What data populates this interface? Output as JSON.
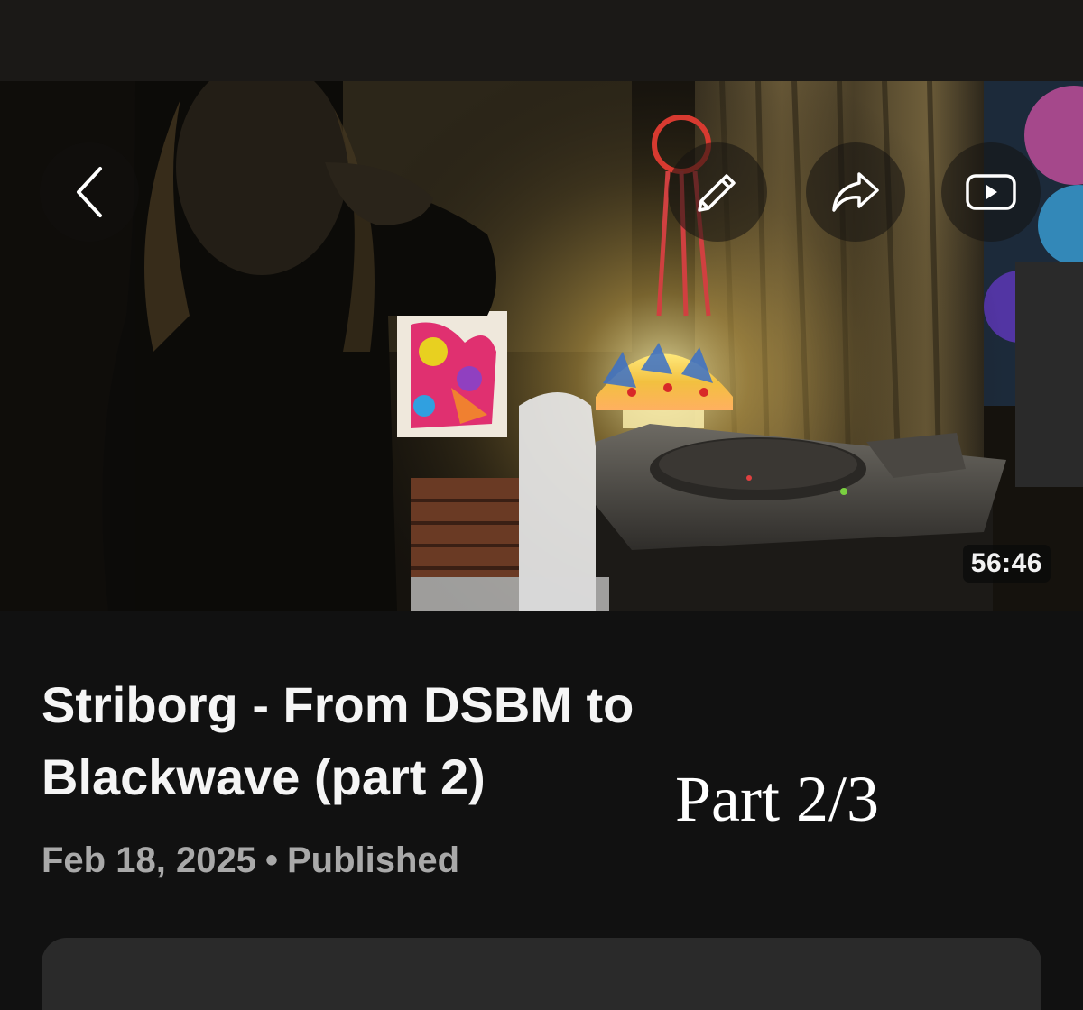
{
  "video": {
    "duration": "56:46"
  },
  "actions": {
    "back_icon": "chevron-left-icon",
    "edit_icon": "pencil-icon",
    "share_icon": "share-arrow-icon",
    "youtube_icon": "youtube-play-icon"
  },
  "post": {
    "title": "Striborg - From DSBM to Blackwave (part 2)",
    "overlay_label": "Part 2/3",
    "date": "Feb 18, 2025",
    "separator": "•",
    "status": "Published"
  },
  "colors": {
    "background": "#111111",
    "top_bar": "#1b1917",
    "title_text": "#f5f5f5",
    "meta_text": "#a9a9a9",
    "card": "#2a2a2a"
  }
}
